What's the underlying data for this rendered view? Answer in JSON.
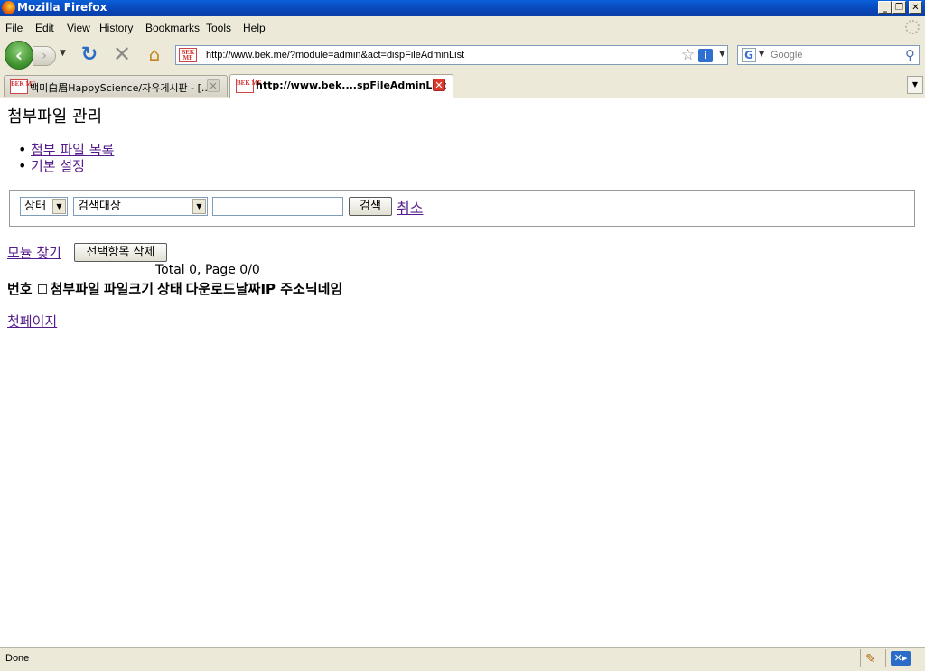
{
  "window": {
    "title": "Mozilla Firefox",
    "controls": {
      "minimize": "_",
      "restore": "❐",
      "close": "✕"
    }
  },
  "menu": {
    "items": [
      "File",
      "Edit",
      "View",
      "History",
      "Bookmarks",
      "Tools",
      "Help"
    ]
  },
  "toolbar": {
    "back_icon": "back-arrow-icon",
    "forward_icon": "forward-arrow-icon",
    "reload_icon": "reload-icon",
    "stop_icon": "stop-icon",
    "home_icon": "home-icon",
    "url": "http://www.bek.me/?module=admin&act=dispFileAdminList",
    "favicon_text": "BEK MF",
    "search_placeholder": "Google",
    "search_engine": "G"
  },
  "tabs": [
    {
      "label": "백미白眉HappyScience/자유게시판 - [...",
      "active": false
    },
    {
      "label": "http://www.bek....spFileAdminList",
      "active": true
    }
  ],
  "page": {
    "title": "첨부파일 관리",
    "nav_links": [
      "첨부 파일 목록",
      "기본 설정"
    ],
    "search": {
      "status_select": "상태",
      "target_select": "검색대상",
      "input_value": "",
      "search_button": "검색",
      "cancel_link": "취소"
    },
    "find_module_link": "모듈 찾기",
    "delete_selected_button": "선택항목 삭제",
    "total_text": "Total 0, Page 0/0",
    "table_headers": [
      "번호",
      "첨부파일",
      "파일크기",
      "상태",
      "다운로드",
      "날짜",
      "IP 주소",
      "닉네임"
    ],
    "first_page_link": "첫페이지"
  },
  "status": {
    "text": "Done"
  }
}
